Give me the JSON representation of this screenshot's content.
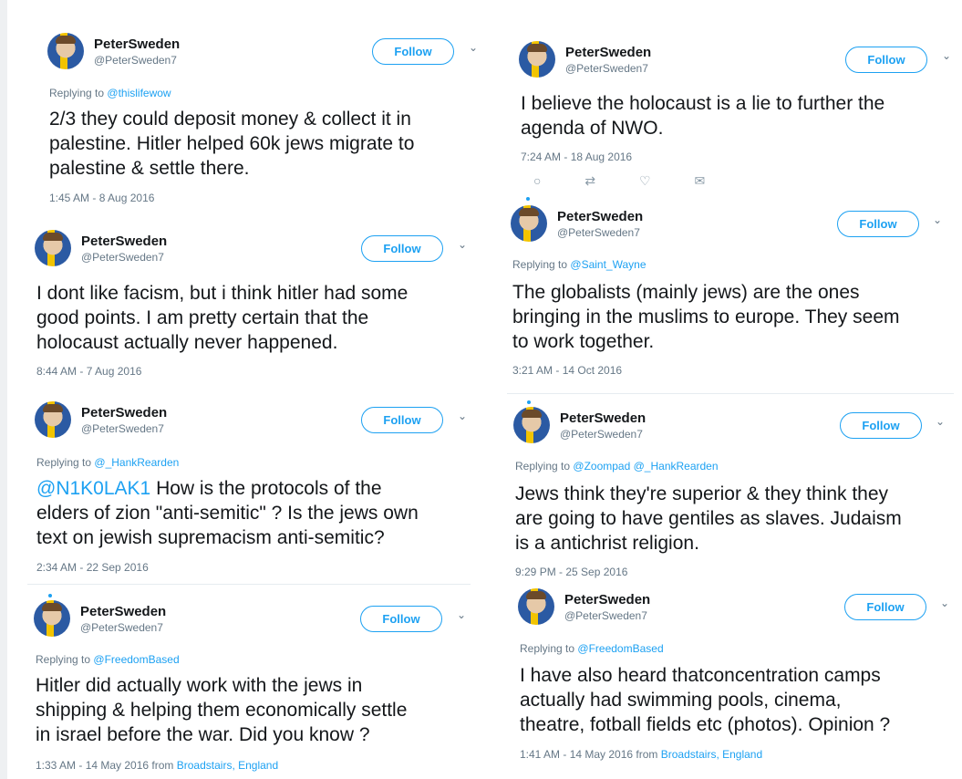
{
  "tweets": [
    {
      "name": "PeterSweden",
      "handle": "@PeterSweden7",
      "follow": "Follow",
      "chevron": "⌄",
      "reply_prefix": "Replying to",
      "reply_to": "@thislifewow",
      "text_lines": [
        "2/3 they could deposit money & collect it in",
        "palestine. Hitler helped 60k jews migrate to",
        "palestine & settle there."
      ],
      "time": "1:45 AM - 8 Aug 2016"
    },
    {
      "name": "PeterSweden",
      "handle": "@PeterSweden7",
      "follow": "Follow",
      "chevron": "⌄",
      "text_lines": [
        "I dont like facism, but i think hitler had some",
        "good points. I am pretty certain that the",
        "holocaust actually never happened."
      ],
      "time": "8:44 AM - 7 Aug 2016"
    },
    {
      "name": "PeterSweden",
      "handle": "@PeterSweden7",
      "follow": "Follow",
      "chevron": "⌄",
      "reply_prefix": "Replying to",
      "reply_to": "@_HankRearden",
      "mention": "@N1K0LAK1",
      "text_first_rest": " How is the protocols of the",
      "text_lines": [
        "@N1K0LAK1 How is the protocols of the",
        "elders of zion \"anti-semitic\" ? Is the jews own",
        "text on jewish supremacism anti-semitic?"
      ],
      "time": "2:34 AM - 22 Sep 2016"
    },
    {
      "name": "PeterSweden",
      "handle": "@PeterSweden7",
      "follow": "Follow",
      "chevron": "⌄",
      "reply_prefix": "Replying to",
      "reply_to": "@FreedomBased",
      "text_lines": [
        "Hitler did actually work with the jews in",
        "shipping & helping them economically settle",
        "in israel before the war. Did you know ?"
      ],
      "time": "1:33 AM - 14 May 2016 from",
      "location": "Broadstairs, England"
    },
    {
      "name": "PeterSweden",
      "handle": "@PeterSweden7",
      "follow": "Follow",
      "chevron": "⌄",
      "text_lines": [
        "I believe the holocaust is a lie to further the",
        "agenda of NWO."
      ],
      "time": "7:24 AM - 18 Aug 2016",
      "actions": [
        "reply-icon",
        "retweet-icon",
        "like-icon",
        "message-icon"
      ]
    },
    {
      "name": "PeterSweden",
      "handle": "@PeterSweden7",
      "follow": "Follow",
      "chevron": "⌄",
      "reply_prefix": "Replying to",
      "reply_to": "@Saint_Wayne",
      "text_lines": [
        "The globalists (mainly jews) are the ones",
        "bringing in the muslims to europe. They seem",
        "to work together."
      ],
      "time": "3:21 AM - 14 Oct 2016"
    },
    {
      "name": "PeterSweden",
      "handle": "@PeterSweden7",
      "follow": "Follow",
      "chevron": "⌄",
      "reply_prefix": "Replying to",
      "reply_to": "@Zoompad",
      "reply_to_2": "@_HankRearden",
      "text_lines": [
        "Jews think they're superior & they think they",
        "are going to have gentiles as slaves. Judaism",
        "is a antichrist religion."
      ],
      "time": "9:29 PM - 25 Sep 2016"
    },
    {
      "name": "PeterSweden",
      "handle": "@PeterSweden7",
      "follow": "Follow",
      "chevron": "⌄",
      "reply_prefix": "Replying to",
      "reply_to": "@FreedomBased",
      "text_lines": [
        "I have also heard thatconcentration camps",
        "actually had swimming pools, cinema,",
        "theatre, fotball fields etc (photos). Opinion ?"
      ],
      "time": "1:41 AM - 14 May 2016 from",
      "location": "Broadstairs, England"
    }
  ],
  "icons": {
    "reply": "○",
    "retweet": "⇄",
    "like": "♡",
    "message": "✉"
  },
  "colors": {
    "accent": "#1da1f2",
    "text": "#14171a",
    "muted": "#657786"
  }
}
